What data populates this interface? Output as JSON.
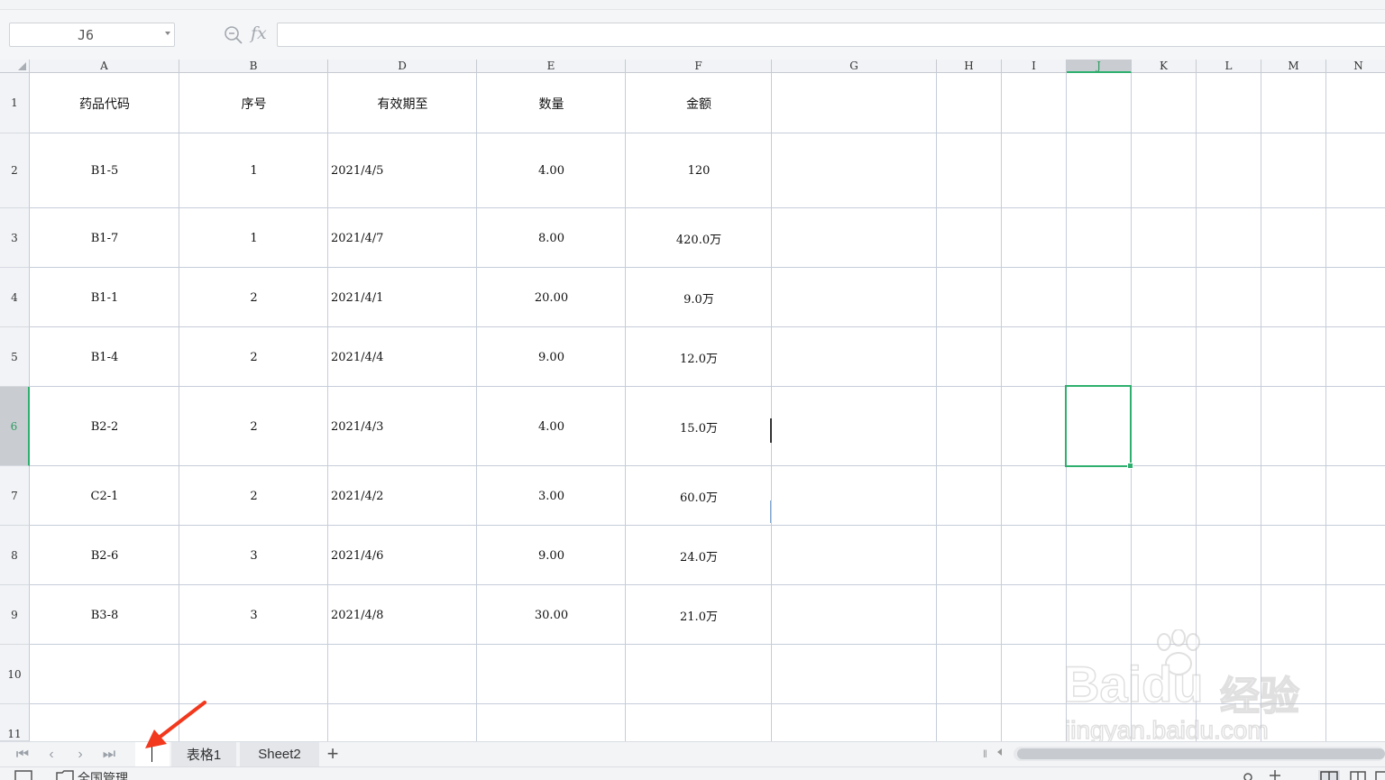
{
  "formula_bar": {
    "name_box_value": "J6",
    "fx_label": "fx",
    "formula_value": ""
  },
  "columns": [
    "A",
    "B",
    "D",
    "E",
    "F",
    "G",
    "H",
    "I",
    "J",
    "K",
    "L",
    "M",
    "N"
  ],
  "selected_column": "J",
  "row_numbers": [
    "1",
    "2",
    "3",
    "4",
    "5",
    "6",
    "7",
    "8",
    "9",
    "10",
    "11"
  ],
  "selected_row": "6",
  "table": {
    "headers": [
      "药品代码",
      "序号",
      "有效期至",
      "数量",
      "金额"
    ],
    "rows": [
      [
        "B1-5",
        "1",
        "2021/4/5",
        "4.00",
        "120"
      ],
      [
        "B1-7",
        "1",
        "2021/4/7",
        "8.00",
        "420.0万"
      ],
      [
        "B1-1",
        "2",
        "2021/4/1",
        "20.00",
        "9.0万"
      ],
      [
        "B1-4",
        "2",
        "2021/4/4",
        "9.00",
        "12.0万"
      ],
      [
        "B2-2",
        "2",
        "2021/4/3",
        "4.00",
        "15.0万"
      ],
      [
        "C2-1",
        "2",
        "2021/4/2",
        "3.00",
        "60.0万"
      ],
      [
        "B2-6",
        "3",
        "2021/4/6",
        "9.00",
        "24.0万"
      ],
      [
        "B3-8",
        "3",
        "2021/4/8",
        "30.00",
        "21.0万"
      ]
    ]
  },
  "sheet_tabs": {
    "active_tab_label": "",
    "tabs": [
      "表格1",
      "Sheet2"
    ],
    "add_label": "+"
  },
  "status_bar": {
    "left_text": "全国管理"
  },
  "watermark": {
    "brand": "Baidu",
    "brand_cn": "经验",
    "url": "jingyan.baidu.com"
  },
  "colors": {
    "selection_green": "#2eaf6e",
    "annotation_arrow": "#f2381d",
    "gridline": "#c6cdd9"
  }
}
